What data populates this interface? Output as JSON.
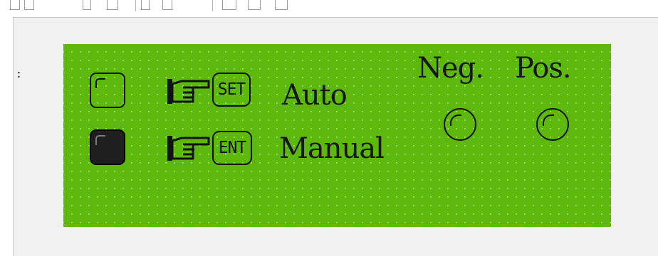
{
  "side_marker": ":",
  "panel": {
    "colors": {
      "lcd": "#5cb80d",
      "ink": "#161616",
      "canvas": "#f1f1f1"
    },
    "rows": [
      {
        "id": "auto",
        "lamp_state": "off",
        "hand_icon": "pointing-hand-icon",
        "key_label": "SET",
        "mode_label": "Auto"
      },
      {
        "id": "manual",
        "lamp_state": "on",
        "hand_icon": "pointing-hand-icon",
        "key_label": "ENT",
        "mode_label": "Manual"
      }
    ],
    "indicators": {
      "negative": {
        "label": "Neg.",
        "icon": "round-indicator-icon"
      },
      "positive": {
        "label": "Pos.",
        "icon": "round-indicator-icon"
      }
    }
  }
}
